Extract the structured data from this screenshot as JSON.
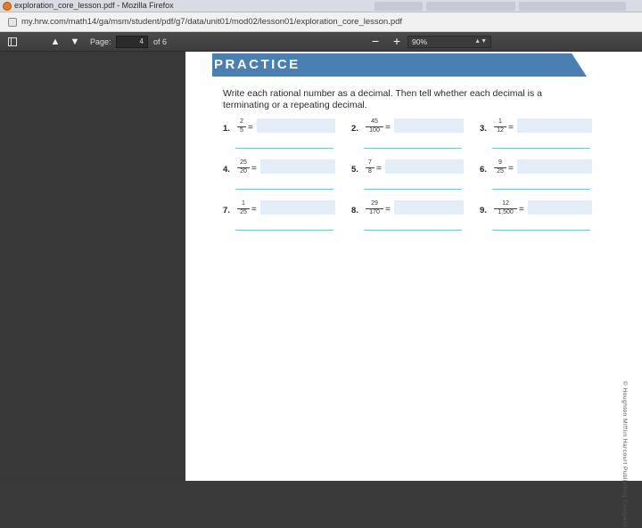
{
  "window": {
    "title": "exploration_core_lesson.pdf - Mozilla Firefox"
  },
  "address_bar": {
    "url": "my.hrw.com/math14/ga/msm/student/pdf/g7/data/unit01/mod02/lesson01/exploration_core_lesson.pdf"
  },
  "pdf_toolbar": {
    "page_label": "Page:",
    "current_page": "4",
    "page_count_label": "of 6",
    "zoom_out_label": "−",
    "zoom_in_label": "+",
    "zoom_value": "90%"
  },
  "document": {
    "banner": "PRACTICE",
    "instructions": "Write each rational number as a decimal. Then tell whether each decimal is a terminating or a repeating decimal.",
    "problems": [
      {
        "number": "1.",
        "numerator": "2",
        "denominator": "5",
        "equals": "="
      },
      {
        "number": "2.",
        "numerator": "45",
        "denominator": "100",
        "equals": "="
      },
      {
        "number": "3.",
        "numerator": "1",
        "denominator": "12",
        "equals": "="
      },
      {
        "number": "4.",
        "numerator": "25",
        "denominator": "20",
        "equals": "="
      },
      {
        "number": "5.",
        "numerator": "7",
        "denominator": "8",
        "equals": "="
      },
      {
        "number": "6.",
        "numerator": "9",
        "denominator": "25",
        "equals": "="
      },
      {
        "number": "7.",
        "numerator": "1",
        "denominator": "25",
        "equals": "="
      },
      {
        "number": "8.",
        "numerator": "29",
        "denominator": "170",
        "equals": "="
      },
      {
        "number": "9.",
        "numerator": "12",
        "denominator": "1,500",
        "equals": "="
      }
    ],
    "copyright": "© Houghton Mifflin Harcourt Publishing Company"
  },
  "colors": {
    "banner": "#4a7fb4",
    "answer_box": "#e3eef8",
    "answer_line": "#7cc4bf",
    "toolbar": "#444444"
  }
}
